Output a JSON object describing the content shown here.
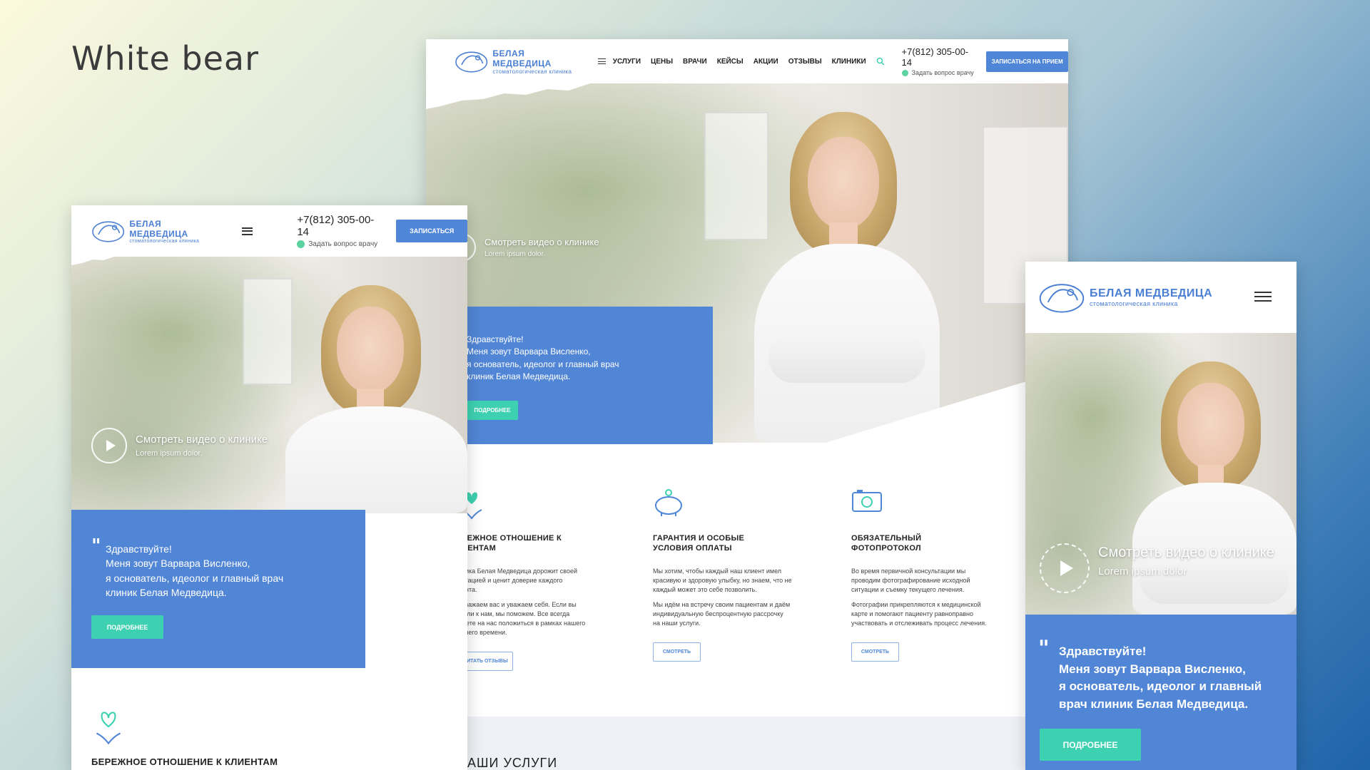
{
  "page_title": "White bear",
  "brand": {
    "name": "БЕЛАЯ МЕДВЕДИЦА",
    "sub": "стоматологическая клиника"
  },
  "colors": {
    "accent_blue": "#4f86d8",
    "accent_green": "#3ed1b1",
    "box_blue": "#5186d6"
  },
  "icons": [
    "bear-logo-icon",
    "menu-icon",
    "search-icon",
    "whatsapp-icon",
    "play-icon",
    "quote-icon",
    "heart-hands-icon",
    "piggy-bank-icon",
    "camera-icon"
  ],
  "desktop": {
    "nav": [
      "УСЛУГИ",
      "ЦЕНЫ",
      "ВРАЧИ",
      "КЕЙСЫ",
      "АКЦИИ",
      "ОТЗЫВЫ",
      "КЛИНИКИ"
    ],
    "phone": "+7(812) 305-00-14",
    "ask": "Задать вопрос врачу",
    "cta": "ЗАПИСАТЬСЯ НА ПРИЕМ",
    "video_title": "Смотреть видео о клинике",
    "video_sub": "Lorem ipsum dolor.",
    "greeting": [
      "Здравствуйте!",
      "Меня зовут Варвара Висленко,",
      "я основатель, идеолог и главный врач",
      "клиник Белая Медведица."
    ],
    "more": "ПОДРОБНЕЕ",
    "features": [
      {
        "title": [
          "РЕЖНОЕ ОТНОШЕНИЕ К",
          "ИЕНТАМ"
        ],
        "p1": [
          "ника Белая Медведица дорожит своей",
          "утацией и ценит доверие каждого",
          "ента."
        ],
        "p2": [
          "уважаем вас и уважаем себя. Если вы",
          "шли к нам, мы поможем. Все всегда",
          "жете на нас положиться в рамках нашего",
          "очего времени."
        ],
        "btn": "ИТАТЬ ОТЗЫВЫ"
      },
      {
        "title": [
          "ГАРАНТИЯ И ОСОБЫЕ",
          "УСЛОВИЯ ОПЛАТЫ"
        ],
        "p1": [
          "Мы хотим, чтобы каждый наш клиент имел",
          "красивую и здоровую улыбку, но знаем, что не",
          "каждый может это себе позволить."
        ],
        "p2": [
          "Мы идём на встречу своим пациентам и даём",
          "индивидуальную беспроцентную рассрочку",
          "на наши услуги."
        ],
        "btn": "СМОТРЕТЬ"
      },
      {
        "title": [
          "ОБЯЗАТЕЛЬНЫЙ",
          "ФОТОПРОТОКОЛ"
        ],
        "p1": [
          "Во время первичной консультации мы",
          "проводим фотографирование исходной",
          "ситуации и съемку текущего лечения."
        ],
        "p2": [
          "Фотографии прикрепляются к медицинской",
          "карте и помогают пациенту равноправно",
          "участвовать и отслеживать процесс лечения."
        ],
        "btn": "СМОТРЕТЬ"
      }
    ],
    "services_heading": "АШИ УСЛУГИ"
  },
  "tablet": {
    "phone": "+7(812) 305-00-14",
    "ask": "Задать вопрос врачу",
    "cta": "ЗАПИСАТЬСЯ",
    "video_title": "Смотреть видео о клинике",
    "video_sub": "Lorem ipsum dolor.",
    "greeting": [
      "Здравствуйте!",
      "Меня зовут Варвара Висленко,",
      "я основатель, идеолог и главный врач",
      "клиник Белая Медведица."
    ],
    "more": "ПОДРОБНЕЕ",
    "feature_title": "БЕРЕЖНОЕ ОТНОШЕНИЕ К КЛИЕНТАМ"
  },
  "mobile": {
    "video_title": "Смотреть видео о клинике",
    "video_sub": "Lorem ipsum dolor",
    "greeting": [
      "Здравствуйте!",
      "Меня зовут Варвара Висленко,",
      "я основатель, идеолог и главный",
      "врач клиник Белая Медведица."
    ],
    "more": "ПОДРОБНЕЕ"
  }
}
